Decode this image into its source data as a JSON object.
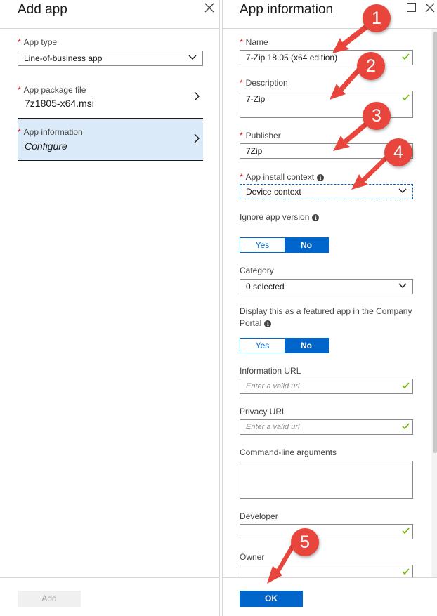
{
  "left_blade": {
    "title": "Add app",
    "app_type": {
      "label": "App type",
      "value": "Line-of-business app"
    },
    "app_package": {
      "label": "App package file",
      "value": "7z1805-x64.msi"
    },
    "app_information": {
      "label": "App information",
      "value": "Configure"
    },
    "add_button": "Add"
  },
  "right_blade": {
    "title": "App information",
    "name": {
      "label": "Name",
      "value": "7-Zip 18.05 (x64 edition)"
    },
    "description": {
      "label": "Description",
      "value": "7-Zip"
    },
    "publisher": {
      "label": "Publisher",
      "value": "7Zip"
    },
    "install_context": {
      "label": "App install context",
      "value": "Device context"
    },
    "ignore_version": {
      "label": "Ignore app version",
      "yes": "Yes",
      "no": "No"
    },
    "category": {
      "label": "Category",
      "value": "0 selected"
    },
    "featured": {
      "label_line1": "Display this as a featured app in the Company",
      "label_line2": "Portal",
      "yes": "Yes",
      "no": "No"
    },
    "information_url": {
      "label": "Information URL",
      "placeholder": "Enter a valid url"
    },
    "privacy_url": {
      "label": "Privacy URL",
      "placeholder": "Enter a valid url"
    },
    "command_line": {
      "label": "Command-line arguments"
    },
    "developer": {
      "label": "Developer"
    },
    "owner": {
      "label": "Owner"
    },
    "ok_button": "OK"
  },
  "annotations": [
    "1",
    "2",
    "3",
    "4",
    "5"
  ],
  "colors": {
    "accent": "#0066cc",
    "required": "#e81123",
    "selected_row": "#dbeaf8",
    "valid_check": "#6bb700",
    "annotation": "#e8453c"
  }
}
